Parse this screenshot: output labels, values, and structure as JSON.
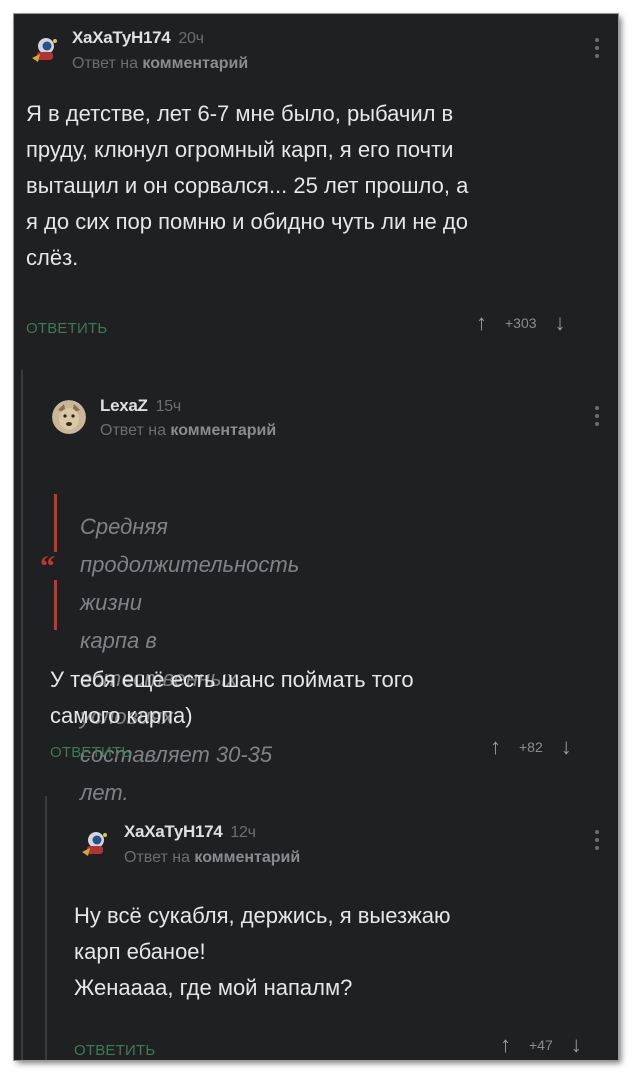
{
  "colors": {
    "background": "#1f2022",
    "reply_button": "#3d7a55",
    "quote_bar": "#c3372f"
  },
  "comments": [
    {
      "author": "ХаХаТуН174",
      "time": "20ч",
      "reply_prefix": "Ответ на",
      "reply_target": "комментарий",
      "text_lines": [
        "Я в детстве, лет 6-7 мне было, рыбачил в",
        "пруду, клюнул огромный карп, я его почти",
        "вытащил и он сорвался... 25 лет прошло, а",
        "я до сих пор помню и обидно чуть ли не до",
        "слёз."
      ],
      "reply_label": "ОТВЕТИТЬ",
      "score": "+303",
      "avatar_icon": "astronaut-avatar"
    },
    {
      "author": "LexaZ",
      "time": "15ч",
      "reply_prefix": "Ответ на",
      "reply_target": "комментарий",
      "quote_lines": [
        "Средняя продолжительность жизни",
        "карпа в естественных условиях",
        "составляет 30-35 лет."
      ],
      "text_lines": [
        "У тебя ещё есть шанс поймать того",
        "самого карпа)"
      ],
      "reply_label": "ОТВЕТИТЬ",
      "score": "+82",
      "avatar_icon": "wolf-avatar"
    },
    {
      "author": "ХаХаТуН174",
      "time": "12ч",
      "reply_prefix": "Ответ на",
      "reply_target": "комментарий",
      "text_lines": [
        "Ну всё сукабля, держись, я выезжаю",
        "карп ебаное!",
        "Женаааа, где мой напалм?"
      ],
      "reply_label": "ОТВЕТИТЬ",
      "score": "+47",
      "avatar_icon": "astronaut-avatar"
    }
  ],
  "icons": {
    "upvote": "↑",
    "downvote": "↓",
    "quote": "“"
  }
}
